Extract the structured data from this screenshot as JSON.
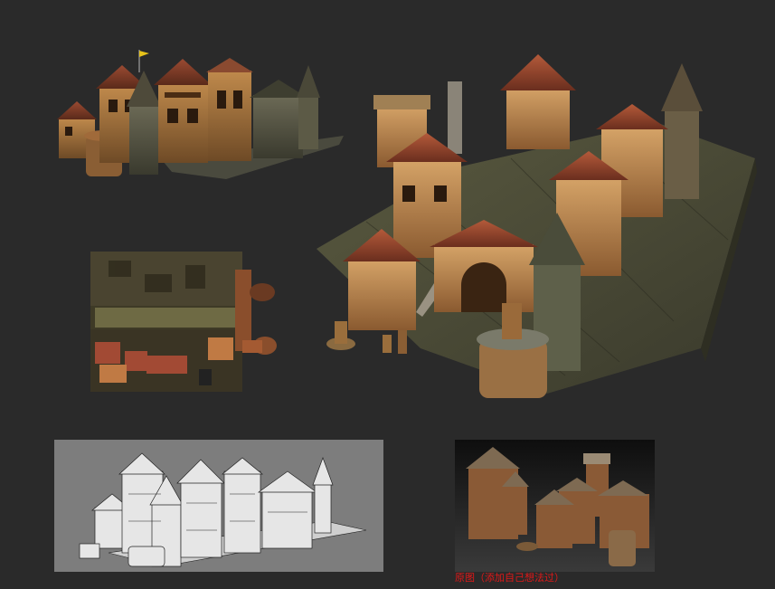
{
  "caption": "原图（添加自己想法过）",
  "colors": {
    "background": "#2a2a2a",
    "caption": "#e01818",
    "wire_panel": "#7d7d7d",
    "ref_panel": "#141414"
  },
  "icons": [
    "town-front-view",
    "town-perspective-view",
    "texture-top-view",
    "wireframe-view",
    "reference-photo"
  ]
}
